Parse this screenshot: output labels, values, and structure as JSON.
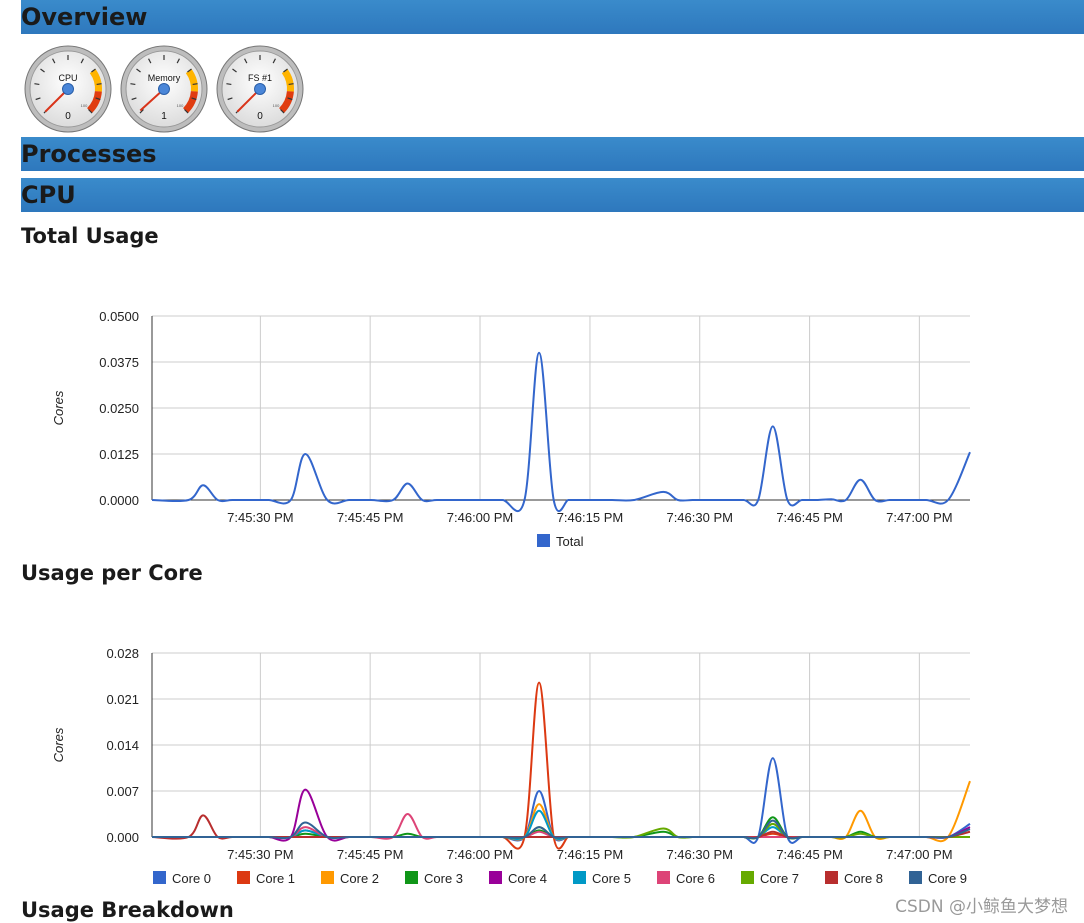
{
  "sections": {
    "overview": "Overview",
    "processes": "Processes",
    "cpu": "CPU",
    "total_usage": "Total Usage",
    "usage_per_core": "Usage per Core",
    "usage_breakdown": "Usage Breakdown"
  },
  "gauges": [
    {
      "label": "CPU",
      "value": "0",
      "needle": 0.0
    },
    {
      "label": "Memory",
      "value": "1",
      "needle": 0.01
    },
    {
      "label": "FS #1",
      "value": "0",
      "needle": 0.0
    }
  ],
  "gauge_scale_label": "100",
  "watermark": "CSDN @小鲸鱼大梦想",
  "colors": {
    "header_bar": "#3584c8",
    "Total": "#3366cc",
    "core": [
      "#3366cc",
      "#dc3912",
      "#ff9900",
      "#109618",
      "#990099",
      "#0099c6",
      "#dd4477",
      "#66aa00",
      "#b82e2e",
      "#316395"
    ]
  },
  "chart_data": [
    {
      "type": "line",
      "title": "Total Usage",
      "ylabel": "Cores",
      "yticks": [
        "0.0500",
        "0.0375",
        "0.0250",
        "0.0125",
        "0.0000"
      ],
      "ylim": [
        0,
        0.05
      ],
      "xticks": [
        "7:45:30 PM",
        "7:45:45 PM",
        "7:46:00 PM",
        "7:46:15 PM",
        "7:46:30 PM",
        "7:46:45 PM",
        "7:47:00 PM"
      ],
      "legend_position": "bottom",
      "x": [
        0,
        5,
        7,
        9,
        11,
        14,
        16,
        19,
        21,
        24,
        27,
        30,
        33,
        35,
        37,
        39,
        42,
        45,
        48,
        51,
        53,
        55,
        57,
        58,
        60,
        63,
        66,
        70,
        72,
        74,
        76,
        78,
        81,
        83,
        85,
        87,
        89,
        91,
        93,
        95,
        97,
        99,
        101,
        103,
        106,
        109,
        112
      ],
      "series": [
        {
          "name": "Total",
          "values": [
            0,
            0,
            0.004,
            0,
            0,
            0,
            0,
            0,
            0.0125,
            0,
            0,
            0,
            0,
            0.0045,
            0,
            0,
            0,
            0,
            0,
            0,
            0.04,
            0,
            0,
            0,
            0,
            0,
            0,
            0.0022,
            0,
            0,
            0,
            0,
            0,
            0,
            0.02,
            0,
            0,
            0,
            0.0002,
            0,
            0.0055,
            0,
            0,
            0,
            0,
            0,
            0.013
          ]
        }
      ]
    },
    {
      "type": "line",
      "title": "Usage per Core",
      "ylabel": "Cores",
      "yticks": [
        "0.028",
        "0.021",
        "0.014",
        "0.007",
        "0.000"
      ],
      "ylim": [
        0,
        0.028
      ],
      "xticks": [
        "7:45:30 PM",
        "7:45:45 PM",
        "7:46:00 PM",
        "7:46:15 PM",
        "7:46:30 PM",
        "7:46:45 PM",
        "7:47:00 PM"
      ],
      "legend_position": "bottom",
      "x": [
        0,
        5,
        7,
        9,
        11,
        14,
        16,
        19,
        21,
        24,
        27,
        30,
        33,
        35,
        37,
        39,
        42,
        45,
        48,
        51,
        53,
        55,
        57,
        58,
        60,
        63,
        66,
        70,
        72,
        74,
        76,
        78,
        81,
        83,
        85,
        87,
        89,
        91,
        93,
        95,
        97,
        99,
        101,
        103,
        106,
        109,
        112
      ],
      "series": [
        {
          "name": "Core 0",
          "values": [
            0,
            0,
            0,
            0,
            0,
            0,
            0,
            0,
            0.001,
            0,
            0,
            0,
            0,
            0,
            0,
            0,
            0,
            0,
            0,
            0,
            0.007,
            0,
            0,
            0,
            0,
            0,
            0,
            0,
            0,
            0,
            0,
            0,
            0,
            0,
            0.012,
            0,
            0,
            0,
            0,
            0,
            0,
            0,
            0,
            0,
            0,
            0,
            0.002
          ]
        },
        {
          "name": "Core 1",
          "values": [
            0,
            0,
            0,
            0,
            0,
            0,
            0,
            0,
            0,
            0,
            0,
            0,
            0,
            0,
            0,
            0,
            0,
            0,
            0,
            0,
            0.0235,
            0,
            0,
            0,
            0,
            0,
            0,
            0,
            0,
            0,
            0,
            0,
            0,
            0,
            0.0005,
            0,
            0,
            0,
            0,
            0,
            0,
            0,
            0,
            0,
            0,
            0,
            0
          ]
        },
        {
          "name": "Core 2",
          "values": [
            0,
            0,
            0,
            0,
            0,
            0,
            0,
            0,
            0,
            0,
            0,
            0,
            0,
            0,
            0,
            0,
            0,
            0,
            0,
            0,
            0.005,
            0,
            0,
            0,
            0,
            0,
            0,
            0,
            0,
            0,
            0,
            0,
            0,
            0,
            0,
            0,
            0,
            0,
            0,
            0,
            0.004,
            0,
            0,
            0,
            0,
            0,
            0.0085
          ]
        },
        {
          "name": "Core 3",
          "values": [
            0,
            0,
            0,
            0,
            0,
            0,
            0,
            0,
            0.0005,
            0,
            0,
            0,
            0,
            0.0005,
            0,
            0,
            0,
            0,
            0,
            0,
            0.001,
            0,
            0,
            0,
            0,
            0,
            0,
            0.0008,
            0,
            0,
            0,
            0,
            0,
            0,
            0.003,
            0,
            0,
            0,
            0,
            0,
            0.0008,
            0,
            0,
            0,
            0,
            0,
            0
          ]
        },
        {
          "name": "Core 4",
          "values": [
            0,
            0,
            0,
            0,
            0,
            0,
            0,
            0,
            0.0072,
            0,
            0,
            0,
            0,
            0,
            0,
            0,
            0,
            0,
            0,
            0,
            0,
            0,
            0,
            0,
            0,
            0,
            0,
            0,
            0,
            0,
            0,
            0,
            0,
            0,
            0,
            0,
            0,
            0,
            0,
            0,
            0,
            0,
            0,
            0,
            0,
            0,
            0.0015
          ]
        },
        {
          "name": "Core 5",
          "values": [
            0,
            0,
            0,
            0,
            0,
            0,
            0,
            0,
            0.001,
            0,
            0,
            0,
            0,
            0,
            0,
            0,
            0,
            0,
            0,
            0,
            0.004,
            0,
            0,
            0,
            0,
            0,
            0,
            0,
            0,
            0,
            0,
            0,
            0,
            0,
            0.0015,
            0,
            0,
            0,
            0,
            0,
            0,
            0,
            0,
            0,
            0,
            0,
            0
          ]
        },
        {
          "name": "Core 6",
          "values": [
            0,
            0,
            0,
            0,
            0,
            0,
            0,
            0,
            0.0015,
            0,
            0,
            0,
            0,
            0.0035,
            0,
            0,
            0,
            0,
            0,
            0,
            0.0008,
            0,
            0,
            0,
            0,
            0,
            0,
            0,
            0,
            0,
            0,
            0,
            0,
            0,
            0,
            0,
            0,
            0,
            0,
            0,
            0,
            0,
            0,
            0,
            0,
            0,
            0
          ]
        },
        {
          "name": "Core 7",
          "values": [
            0,
            0,
            0,
            0,
            0,
            0,
            0,
            0,
            0,
            0,
            0,
            0,
            0,
            0,
            0,
            0,
            0,
            0,
            0,
            0,
            0.0015,
            0,
            0,
            0,
            0,
            0,
            0,
            0.0013,
            0,
            0,
            0,
            0,
            0,
            0,
            0.002,
            0,
            0,
            0,
            0,
            0,
            0.0005,
            0,
            0,
            0,
            0,
            0,
            0
          ]
        },
        {
          "name": "Core 8",
          "values": [
            0,
            0,
            0.0033,
            0,
            0,
            0,
            0,
            0,
            0,
            0,
            0,
            0,
            0,
            0,
            0,
            0,
            0,
            0,
            0,
            0,
            0,
            0,
            0,
            0,
            0,
            0,
            0,
            0,
            0,
            0,
            0,
            0,
            0,
            0,
            0.0008,
            0,
            0,
            0,
            0,
            0,
            0,
            0,
            0,
            0,
            0,
            0,
            0.0008
          ]
        },
        {
          "name": "Core 9",
          "values": [
            0,
            0,
            0,
            0,
            0,
            0,
            0,
            0,
            0.0022,
            0,
            0,
            0,
            0,
            0,
            0,
            0,
            0,
            0,
            0,
            0,
            0.0015,
            0,
            0,
            0,
            0,
            0,
            0,
            0,
            0,
            0,
            0,
            0,
            0,
            0,
            0.0025,
            0,
            0,
            0,
            0,
            0,
            0,
            0,
            0,
            0,
            0,
            0,
            0.0012
          ]
        }
      ]
    }
  ]
}
